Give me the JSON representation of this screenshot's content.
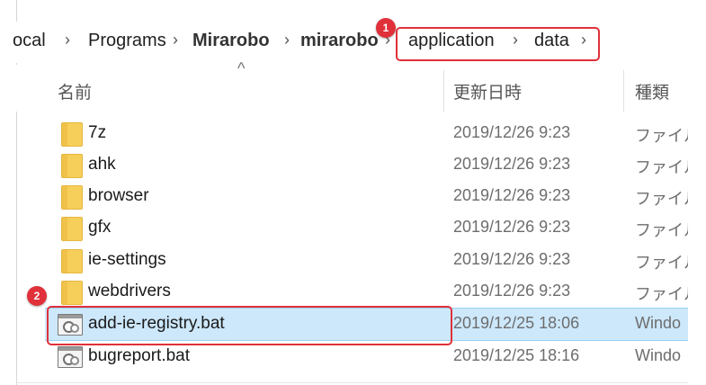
{
  "breadcrumb": {
    "items": [
      {
        "label": "ocal",
        "bold": false
      },
      {
        "label": "Programs",
        "bold": false
      },
      {
        "label": "Mirarobo",
        "bold": true
      },
      {
        "label": "mirarobo",
        "bold": true
      },
      {
        "label": "application",
        "bold": false
      },
      {
        "label": "data",
        "bold": false
      }
    ],
    "separator": "›"
  },
  "columns": {
    "name": "名前",
    "date": "更新日時",
    "type": "種類",
    "sort_indicator": "^"
  },
  "callouts": {
    "one": "1",
    "two": "2"
  },
  "files": [
    {
      "name": "7z",
      "date": "2019/12/26 9:23",
      "type": "ファイル",
      "kind": "folder",
      "selected": false
    },
    {
      "name": "ahk",
      "date": "2019/12/26 9:23",
      "type": "ファイル",
      "kind": "folder",
      "selected": false
    },
    {
      "name": "browser",
      "date": "2019/12/26 9:23",
      "type": "ファイル",
      "kind": "folder",
      "selected": false
    },
    {
      "name": "gfx",
      "date": "2019/12/26 9:23",
      "type": "ファイル",
      "kind": "folder",
      "selected": false
    },
    {
      "name": "ie-settings",
      "date": "2019/12/26 9:23",
      "type": "ファイル",
      "kind": "folder",
      "selected": false
    },
    {
      "name": "webdrivers",
      "date": "2019/12/26 9:23",
      "type": "ファイル",
      "kind": "folder",
      "selected": false
    },
    {
      "name": "add-ie-registry.bat",
      "date": "2019/12/25 18:06",
      "type": "Windo",
      "kind": "bat",
      "selected": true
    },
    {
      "name": "bugreport.bat",
      "date": "2019/12/25 18:16",
      "type": "Windo",
      "kind": "bat",
      "selected": false
    }
  ],
  "colors": {
    "highlight": "#e0303a",
    "selection": "#cde8fb"
  }
}
